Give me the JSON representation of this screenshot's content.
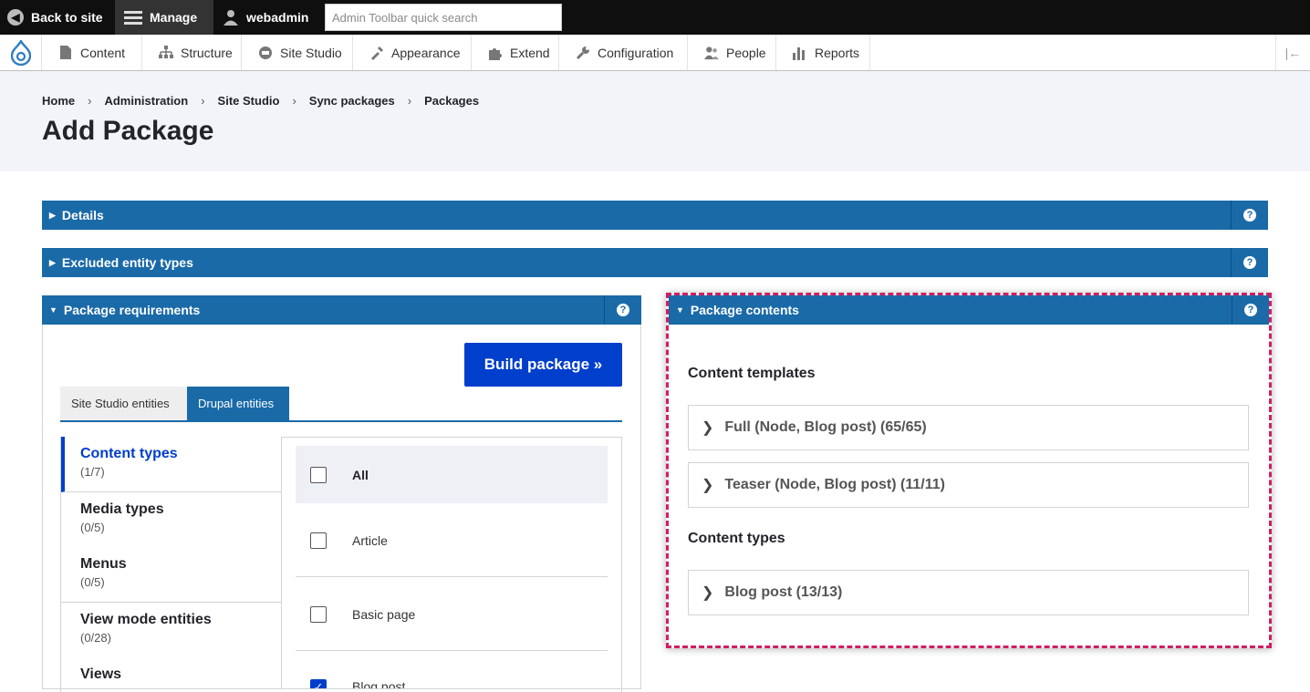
{
  "toolbar": {
    "back_label": "Back to site",
    "manage_label": "Manage",
    "user_label": "webadmin",
    "search_placeholder": "Admin Toolbar quick search"
  },
  "menu": {
    "items": [
      {
        "label": "Content",
        "icon": "page-icon"
      },
      {
        "label": "Structure",
        "icon": "sitemap-icon"
      },
      {
        "label": "Site Studio",
        "icon": "site-studio-icon"
      },
      {
        "label": "Appearance",
        "icon": "paintbrush-icon"
      },
      {
        "label": "Extend",
        "icon": "puzzle-icon"
      },
      {
        "label": "Configuration",
        "icon": "wrench-icon"
      },
      {
        "label": "People",
        "icon": "people-icon"
      },
      {
        "label": "Reports",
        "icon": "bar-chart-icon"
      }
    ]
  },
  "breadcrumb": [
    "Home",
    "Administration",
    "Site Studio",
    "Sync packages",
    "Packages"
  ],
  "page_title": "Add Package",
  "panels": {
    "details": "Details",
    "excluded": "Excluded entity types",
    "requirements": "Package requirements",
    "contents": "Package contents"
  },
  "requirements": {
    "build_button": "Build package »",
    "tabs": [
      "Site Studio entities",
      "Drupal entities"
    ],
    "active_tab": "Drupal entities",
    "vertical_tabs": [
      {
        "name": "Content types",
        "count": "(1/7)"
      },
      {
        "name": "Media types",
        "count": "(0/5)"
      },
      {
        "name": "Menus",
        "count": "(0/5)"
      },
      {
        "name": "View mode entities",
        "count": "(0/28)"
      },
      {
        "name": "Views",
        "count": ""
      }
    ],
    "checkboxes": [
      {
        "label": "All",
        "checked": false
      },
      {
        "label": "Article",
        "checked": false
      },
      {
        "label": "Basic page",
        "checked": false
      },
      {
        "label": "Blog post",
        "checked": true
      }
    ]
  },
  "contents": {
    "templates_heading": "Content templates",
    "templates": [
      "Full (Node, Blog post) (65/65)",
      "Teaser (Node, Blog post) (11/11)"
    ],
    "types_heading": "Content types",
    "types": [
      "Blog post (13/13)"
    ]
  },
  "colors": {
    "panel_blue": "#1a6aa8",
    "button_blue": "#003ecc",
    "highlight_pink": "#d01e63"
  }
}
